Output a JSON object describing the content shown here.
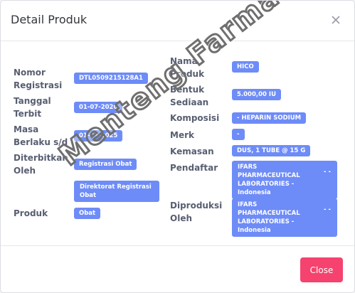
{
  "modal": {
    "title": "Detail Produk",
    "close_button_label": "Close"
  },
  "left_fields": [
    {
      "label": "Nomor Registrasi",
      "value": "DTL0509215128A1"
    },
    {
      "label": "Tanggal Terbit",
      "value": "01-07-2020"
    },
    {
      "label": "Masa Berlaku s/d",
      "value": "01-07-2025"
    },
    {
      "label": "Diterbitkan Oleh",
      "value": "Registrasi Obat"
    },
    {
      "label": "",
      "value": "Direktorat Registrasi Obat"
    },
    {
      "label": "Produk",
      "value": "Obat"
    }
  ],
  "right_fields": [
    {
      "label": "Nama Produk",
      "value": "HICO"
    },
    {
      "label": "Bentuk Sediaan",
      "value": "5.000,00 IU"
    },
    {
      "label": "Komposisi",
      "value": "- HEPARIN SODIUM"
    },
    {
      "label": "Merk",
      "value": "-"
    },
    {
      "label": "Kemasan",
      "value": "DUS, 1 TUBE @ 15 G"
    },
    {
      "label": "Pendaftar",
      "value": "IFARS PHARMACEUTICAL LABORATORIES - Indonesia",
      "tail": "- -"
    },
    {
      "label": "Diproduksi Oleh",
      "value": "IFARS PHARMACEUTICAL LABORATORIES - Indonesia",
      "tail": "- -"
    }
  ],
  "watermark": "Menteng Farma",
  "colors": {
    "badge": "#6e8cf7",
    "close_button": "#f5426e",
    "label": "#585e71"
  }
}
